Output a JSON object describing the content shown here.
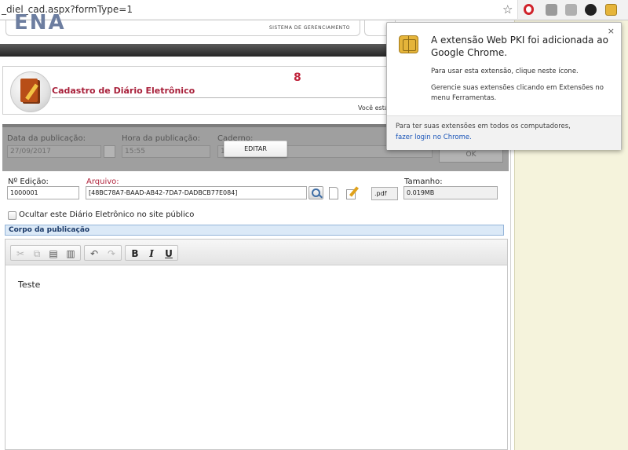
{
  "browser": {
    "url": "_diel_cad.aspx?formType=1",
    "bookmark_icon": "star-icon",
    "extensions": [
      "opera-icon",
      "extension-icon",
      "acrobat-icon",
      "dark-circle-icon",
      "smartcard-chip-icon"
    ]
  },
  "header": {
    "logo_partial": "ENA",
    "system_label": "SISTEMA DE GERENCIAMENTO",
    "page_title": "Cadastro de Diário Eletrônico",
    "badge_number": "8",
    "user_prefix": "Você está"
  },
  "disabled_section": {
    "data_label": "Data da publicação:",
    "data_value": "27/09/2017",
    "hora_label": "Hora da publicação:",
    "hora_value": "15:55",
    "caderno_label": "Caderno:",
    "caderno_value": "1",
    "ok_label": "OK"
  },
  "editar_label": "EDITAR",
  "form": {
    "edicao_label": "Nº Edição:",
    "edicao_value": "1000001",
    "arquivo_label": "Arquivo:",
    "arquivo_value": "[48BC78A7-BAAD-AB42-7DA7-DADBCB77E084]",
    "ext_value": ".pdf",
    "tamanho_label": "Tamanho:",
    "tamanho_value": "0.019MB",
    "ocultar_label": "Ocultar este Diário Eletrônico no site público",
    "ocultar_checked": false
  },
  "corpo": {
    "header": "Corpo da publicação",
    "toolbar": {
      "cut": "✂",
      "copy": "⧉",
      "paste": "▤",
      "paste_text": "▥",
      "undo": "↶",
      "redo": "↷",
      "bold": "B",
      "italic": "I",
      "underline": "U"
    },
    "content": "Teste"
  },
  "popup": {
    "close": "×",
    "title": "A extensão Web PKI foi adicionada ao Google Chrome.",
    "line1": "Para usar esta extensão, clique neste ícone.",
    "line2": "Gerencie suas extensões clicando em Extensões no menu Ferramentas.",
    "footer_text": "Para ter suas extensões em todos os computadores,",
    "footer_link": "fazer login no Chrome."
  },
  "colors": {
    "accent_red": "#b0223a",
    "link_blue": "#1a55b8",
    "section_blue": "#dbe9f7"
  }
}
